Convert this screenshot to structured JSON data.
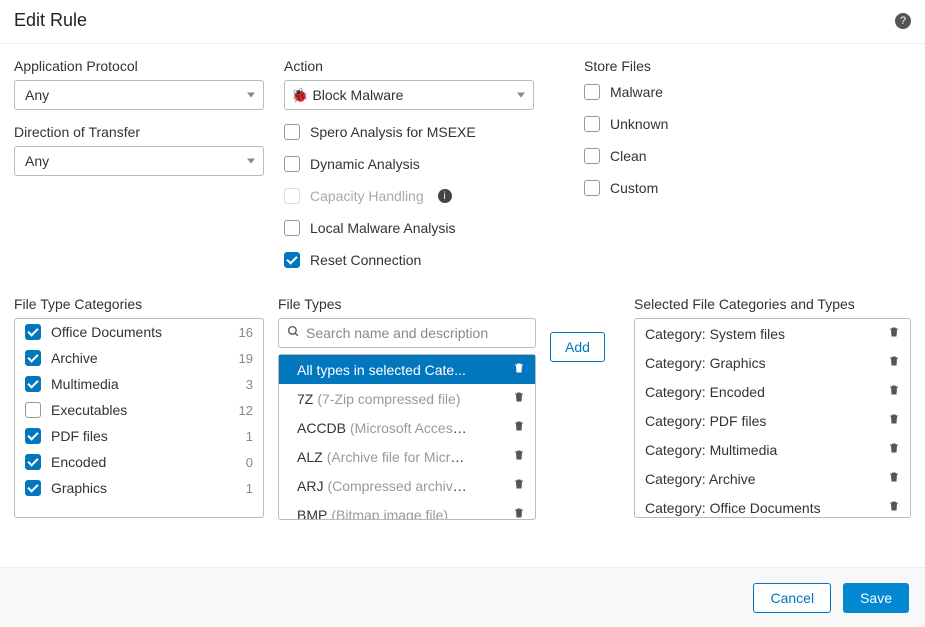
{
  "header": {
    "title": "Edit Rule"
  },
  "app_protocol": {
    "label": "Application Protocol",
    "value": "Any"
  },
  "direction": {
    "label": "Direction of Transfer",
    "value": "Any"
  },
  "action": {
    "label": "Action",
    "value": "Block Malware",
    "checks": [
      {
        "id": "spero",
        "label": "Spero Analysis for MSEXE",
        "checked": false,
        "disabled": false
      },
      {
        "id": "dynamic",
        "label": "Dynamic Analysis",
        "checked": false,
        "disabled": false
      },
      {
        "id": "capacity",
        "label": "Capacity Handling",
        "checked": false,
        "disabled": true,
        "info": true
      },
      {
        "id": "local",
        "label": "Local Malware Analysis",
        "checked": false,
        "disabled": false
      },
      {
        "id": "reset",
        "label": "Reset Connection",
        "checked": true,
        "disabled": false
      }
    ]
  },
  "store": {
    "label": "Store Files",
    "checks": [
      {
        "id": "malware",
        "label": "Malware",
        "checked": false
      },
      {
        "id": "unknown",
        "label": "Unknown",
        "checked": false
      },
      {
        "id": "clean",
        "label": "Clean",
        "checked": false
      },
      {
        "id": "custom",
        "label": "Custom",
        "checked": false
      }
    ]
  },
  "categories": {
    "label": "File Type Categories",
    "items": [
      {
        "name": "Office Documents",
        "count": 16,
        "checked": true
      },
      {
        "name": "Archive",
        "count": 19,
        "checked": true
      },
      {
        "name": "Multimedia",
        "count": 3,
        "checked": true
      },
      {
        "name": "Executables",
        "count": 12,
        "checked": false
      },
      {
        "name": "PDF files",
        "count": 1,
        "checked": true
      },
      {
        "name": "Encoded",
        "count": 0,
        "checked": true
      },
      {
        "name": "Graphics",
        "count": 1,
        "checked": true
      }
    ]
  },
  "types": {
    "label": "File Types",
    "search_placeholder": "Search name and description",
    "items": [
      {
        "name": "All types in selected Cate...",
        "desc": "",
        "selected": true
      },
      {
        "name": "7Z",
        "desc": "(7-Zip compressed file)",
        "selected": false
      },
      {
        "name": "ACCDB",
        "desc": "(Microsoft Access...",
        "selected": false
      },
      {
        "name": "ALZ",
        "desc": "(Archive file for Micro...",
        "selected": false
      },
      {
        "name": "ARJ",
        "desc": "(Compressed archive...",
        "selected": false
      },
      {
        "name": "BMP",
        "desc": "(Bitmap image file)",
        "selected": false
      }
    ]
  },
  "add_label": "Add",
  "selected": {
    "label": "Selected File Categories and Types",
    "items": [
      {
        "name": "Category: System files"
      },
      {
        "name": "Category: Graphics"
      },
      {
        "name": "Category: Encoded"
      },
      {
        "name": "Category: PDF files"
      },
      {
        "name": "Category: Multimedia"
      },
      {
        "name": "Category: Archive"
      },
      {
        "name": "Category: Office Documents"
      }
    ]
  },
  "footer": {
    "cancel": "Cancel",
    "save": "Save"
  }
}
